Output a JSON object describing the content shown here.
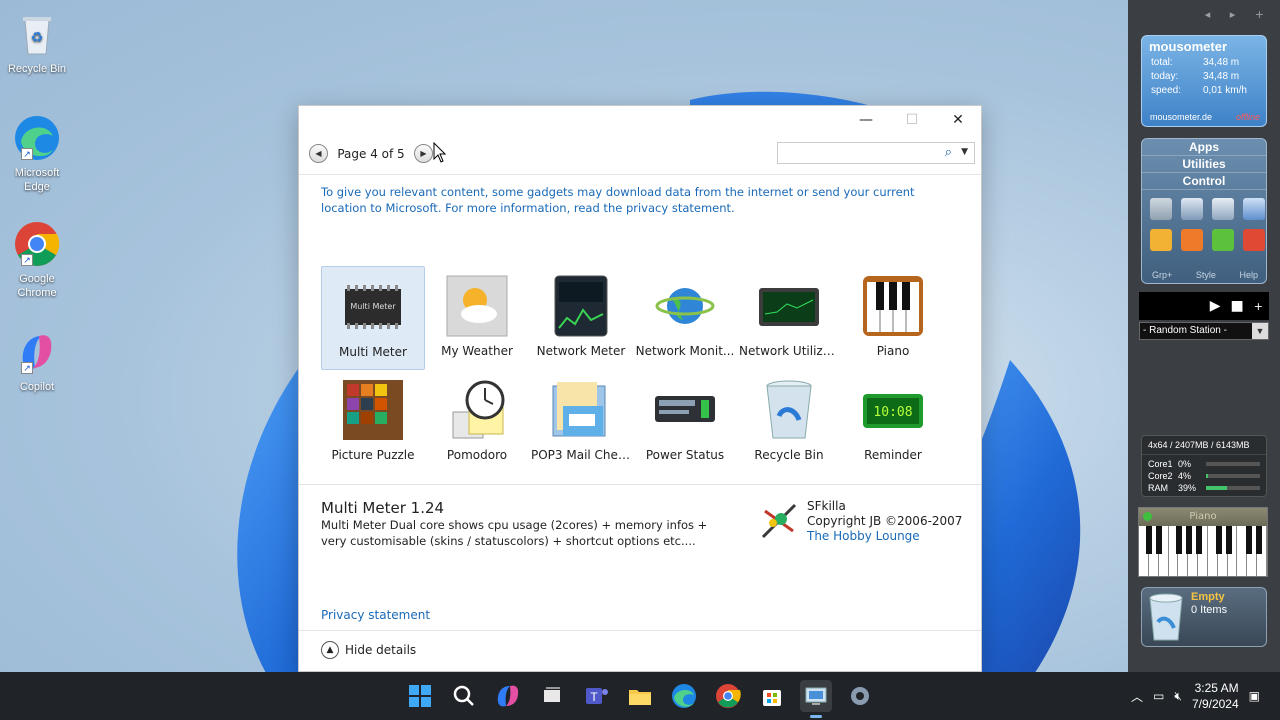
{
  "desktop": {
    "icons": [
      {
        "label": "Recycle Bin"
      },
      {
        "label": "Microsoft Edge"
      },
      {
        "label": "Google Chrome"
      },
      {
        "label": "Copilot"
      }
    ]
  },
  "sidebar": {
    "mousometer": {
      "title": "mousometer",
      "rows": [
        {
          "key": "total:",
          "value": "34,48 m"
        },
        {
          "key": "today:",
          "value": "34,48 m"
        },
        {
          "key": "speed:",
          "value": "0,01 km/h"
        }
      ],
      "site": "mousometer.de",
      "status": "offline"
    },
    "launcher": {
      "headers": [
        "Apps",
        "Utilities",
        "Control"
      ],
      "footer": [
        "Grp+",
        "Style",
        "Help"
      ]
    },
    "radio": {
      "station": "- Random Station -"
    },
    "meter": {
      "header": "4x64 / 2407MB / 6143MB",
      "rows": [
        {
          "key": "Core1",
          "value": "0%",
          "fill": 0
        },
        {
          "key": "Core2",
          "value": "4%",
          "fill": 0.04
        },
        {
          "key": "RAM",
          "value": "39%",
          "fill": 0.39
        }
      ]
    },
    "piano": {
      "title": "Piano"
    },
    "bin": {
      "state": "Empty",
      "items": "0 Items"
    }
  },
  "dialog": {
    "pager": {
      "label": "Page 4 of 5",
      "prev_icon": "prev-arrow-icon",
      "next_icon": "next-arrow-icon"
    },
    "search": {
      "placeholder": "",
      "icon": "search-icon"
    },
    "notice": "To give you relevant content, some gadgets may download data from the internet or send your current location to Microsoft. For more information, read the privacy statement.",
    "gadgets": [
      {
        "name": "Multi Meter",
        "selected": true
      },
      {
        "name": "My Weather"
      },
      {
        "name": "Network Meter"
      },
      {
        "name": "Network Monit..."
      },
      {
        "name": "Network Utilizat..."
      },
      {
        "name": "Piano"
      },
      {
        "name": "Picture Puzzle"
      },
      {
        "name": "Pomodoro"
      },
      {
        "name": "POP3 Mail Chec..."
      },
      {
        "name": "Power Status"
      },
      {
        "name": "Recycle Bin"
      },
      {
        "name": "Reminder"
      }
    ],
    "details": {
      "title": "Multi Meter 1.24",
      "description": "Multi Meter Dual core shows cpu usage (2cores) + memory infos + very customisable (skins / statuscolors) + shortcut options etc....",
      "author": "SFkilla",
      "copyright": "Copyright JB ©2006-2007",
      "link": "The Hobby Lounge"
    },
    "privacy": "Privacy statement",
    "hide_details": "Hide details"
  },
  "taskbar": {
    "apps": [
      "start-icon",
      "search-icon",
      "copilot-icon",
      "task-view-icon",
      "teams-icon",
      "file-explorer-icon",
      "edge-icon",
      "chrome-icon",
      "store-icon",
      "gadgets-icon",
      "settings-icon"
    ],
    "time": "3:25 AM",
    "date": "7/9/2024"
  },
  "colors": {
    "accent": "#1a6ab8",
    "taskbar": "#202327",
    "sidebar": "#3b3f44"
  }
}
